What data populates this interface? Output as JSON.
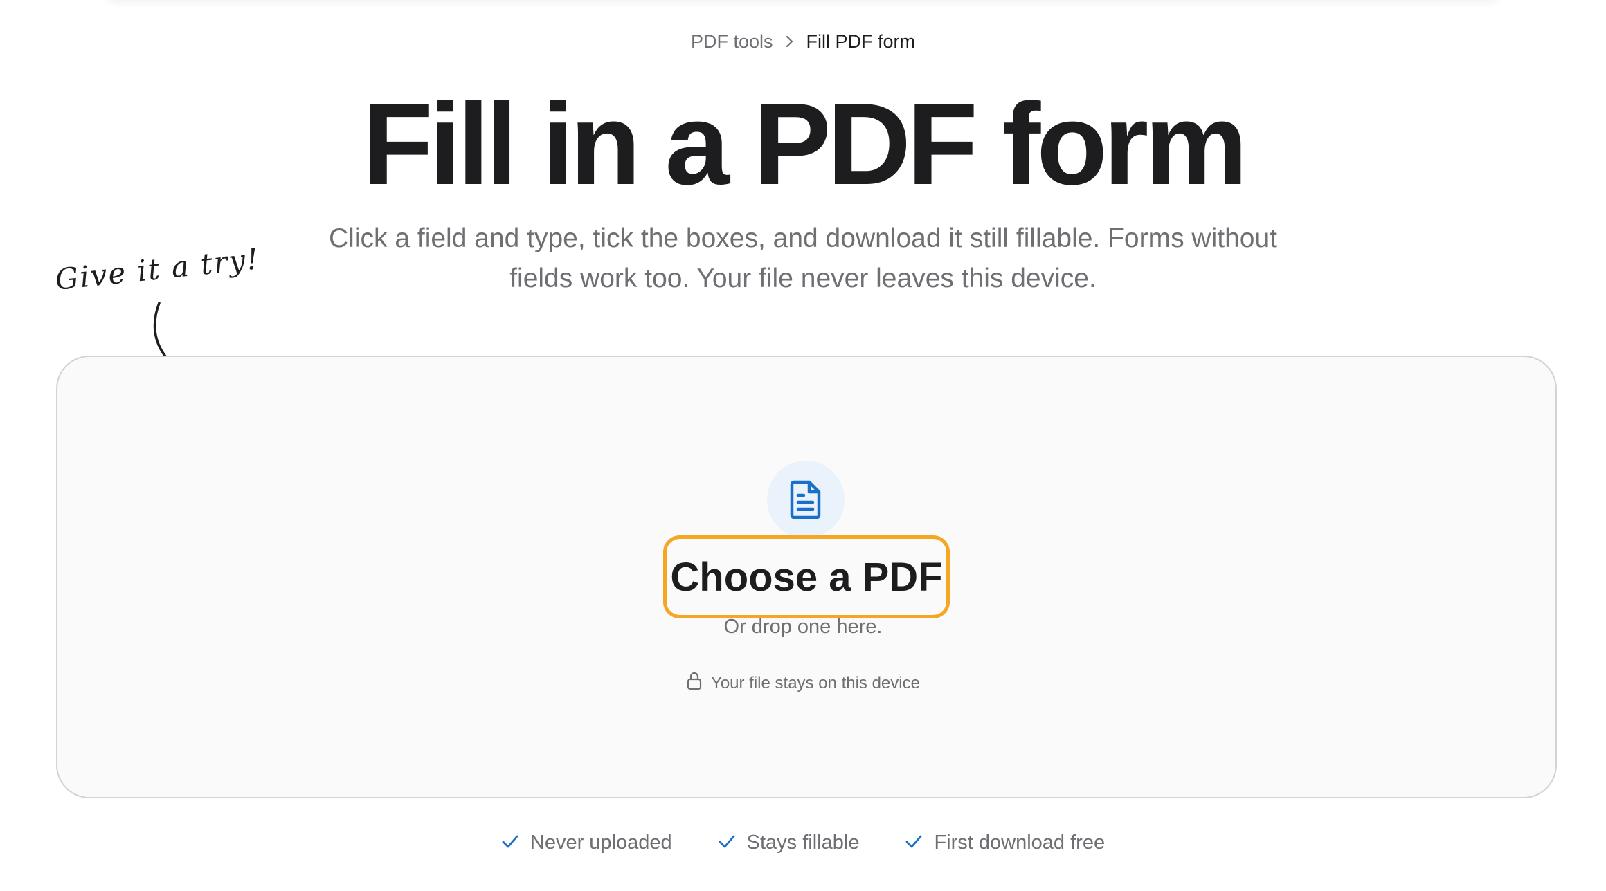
{
  "breadcrumb": {
    "parent": "PDF tools",
    "current": "Fill PDF form"
  },
  "hero": {
    "title": "Fill in a PDF form",
    "subtitle": "Click a field and type, tick the boxes, and download it still fillable. Forms without fields work too. Your file never leaves this device."
  },
  "hint": {
    "text": "Give it a try!"
  },
  "dropzone": {
    "icon": "file-text-icon",
    "button_label": "Choose a PDF",
    "drop_text": "Or drop one here.",
    "privacy_icon": "lock-icon",
    "privacy_text": "Your file stays on this device"
  },
  "features": [
    {
      "icon": "check-icon",
      "label": "Never uploaded"
    },
    {
      "icon": "check-icon",
      "label": "Stays fillable"
    },
    {
      "icon": "check-icon",
      "label": "First download free"
    }
  ],
  "colors": {
    "accent_blue": "#1a6fc9",
    "button_outline": "#f5a623",
    "text_primary": "#1d1d1f",
    "text_secondary": "#6e6e73",
    "dropzone_bg": "#fafafa",
    "icon_bg": "#eaf2fb"
  }
}
